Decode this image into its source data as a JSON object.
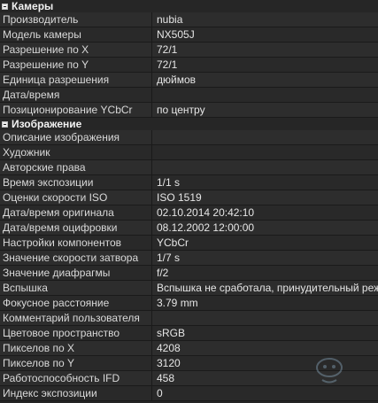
{
  "sections": [
    {
      "title": "Камеры",
      "rows": [
        {
          "key": "Производитель",
          "value": "nubia"
        },
        {
          "key": "Модель камеры",
          "value": "NX505J"
        },
        {
          "key": "Разрешение по X",
          "value": "72/1"
        },
        {
          "key": "Разрешение по Y",
          "value": "72/1"
        },
        {
          "key": "Единица разрешения",
          "value": "дюймов"
        },
        {
          "key": "Дата/время",
          "value": ""
        },
        {
          "key": "Позиционирование YCbCr",
          "value": "по центру"
        }
      ]
    },
    {
      "title": "Изображение",
      "rows": [
        {
          "key": "Описание изображения",
          "value": ""
        },
        {
          "key": "Художник",
          "value": ""
        },
        {
          "key": "Авторские права",
          "value": ""
        },
        {
          "key": "Время экспозиции",
          "value": "1/1 s"
        },
        {
          "key": "Оценки скорости ISO",
          "value": "ISO 1519"
        },
        {
          "key": "Дата/время оригинала",
          "value": "02.10.2014 20:42:10"
        },
        {
          "key": "Дата/время оцифровки",
          "value": "08.12.2002 12:00:00"
        },
        {
          "key": "Настройки компонентов",
          "value": "YCbCr"
        },
        {
          "key": "Значение скорости затвора",
          "value": "1/7 s"
        },
        {
          "key": "Значение диафрагмы",
          "value": "f/2"
        },
        {
          "key": "Вспышка",
          "value": "Вспышка не сработала, принудительный режим"
        },
        {
          "key": "Фокусное расстояние",
          "value": "3.79 mm"
        },
        {
          "key": "Комментарий пользователя",
          "value": ""
        },
        {
          "key": "Цветовое пространство",
          "value": "sRGB"
        },
        {
          "key": "Пикселов по X",
          "value": "4208"
        },
        {
          "key": "Пикселов по Y",
          "value": "3120"
        },
        {
          "key": "Работоспособность IFD",
          "value": "458"
        },
        {
          "key": "Индекс экспозиции",
          "value": "0"
        }
      ]
    }
  ]
}
